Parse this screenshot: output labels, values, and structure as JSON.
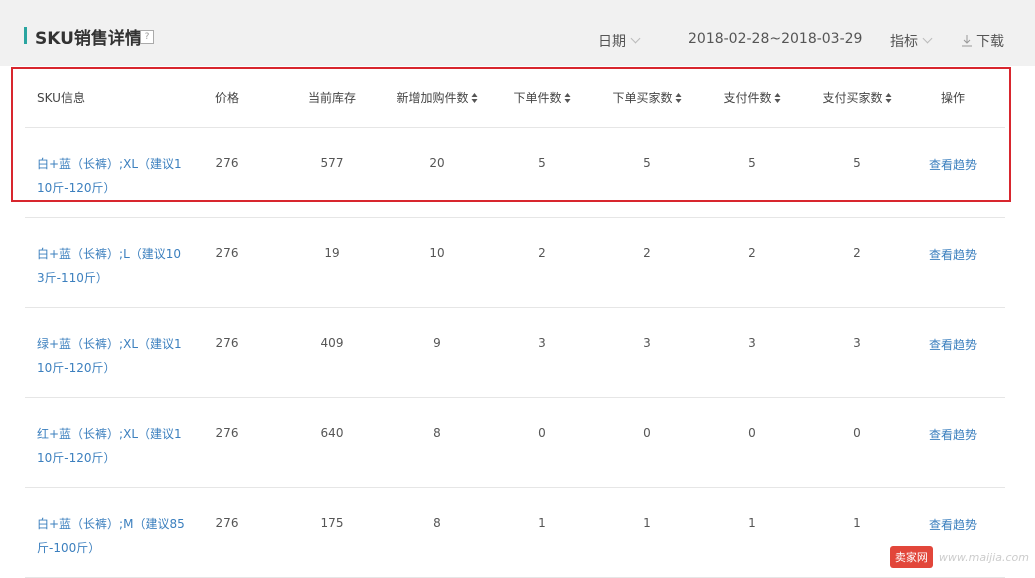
{
  "header": {
    "title": "SKU销售详情",
    "help": "?",
    "date_label": "日期",
    "date_range": "2018-02-28~2018-03-29",
    "metrics_label": "指标",
    "download_label": "下载"
  },
  "table": {
    "columns": [
      "SKU信息",
      "价格",
      "当前库存",
      "新增加购件数",
      "下单件数",
      "下单买家数",
      "支付件数",
      "支付买家数",
      "操作"
    ],
    "rows": [
      {
        "sku": "白+蓝（长裤）;XL（建议110斤-120斤）",
        "price": "276",
        "stock": "577",
        "cart": "20",
        "orders": "5",
        "order_buyers": "5",
        "paid": "5",
        "paid_buyers": "5",
        "action": "查看趋势"
      },
      {
        "sku": "白+蓝（长裤）;L（建议103斤-110斤）",
        "price": "276",
        "stock": "19",
        "cart": "10",
        "orders": "2",
        "order_buyers": "2",
        "paid": "2",
        "paid_buyers": "2",
        "action": "查看趋势"
      },
      {
        "sku": "绿+蓝（长裤）;XL（建议110斤-120斤）",
        "price": "276",
        "stock": "409",
        "cart": "9",
        "orders": "3",
        "order_buyers": "3",
        "paid": "3",
        "paid_buyers": "3",
        "action": "查看趋势"
      },
      {
        "sku": "红+蓝（长裤）;XL（建议110斤-120斤）",
        "price": "276",
        "stock": "640",
        "cart": "8",
        "orders": "0",
        "order_buyers": "0",
        "paid": "0",
        "paid_buyers": "0",
        "action": "查看趋势"
      },
      {
        "sku": "白+蓝（长裤）;M（建议85斤-100斤）",
        "price": "276",
        "stock": "175",
        "cart": "8",
        "orders": "1",
        "order_buyers": "1",
        "paid": "1",
        "paid_buyers": "1",
        "action": "查看趋势"
      }
    ]
  },
  "watermark": {
    "logo": "卖家网",
    "url": "www.maijia.com"
  },
  "colors": {
    "accent": "#2aa5a0",
    "link": "#3b7fbe",
    "highlight": "#d8262e"
  }
}
